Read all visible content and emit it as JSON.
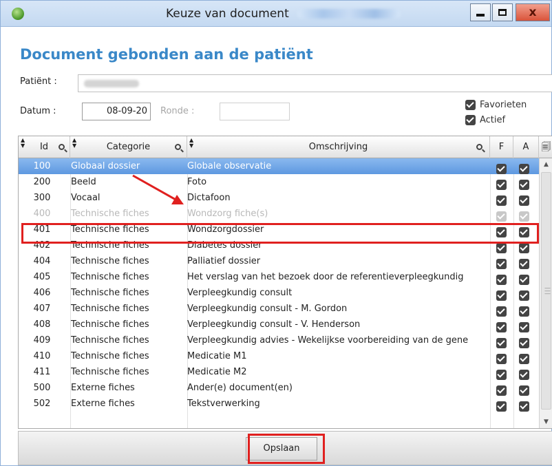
{
  "window": {
    "title": "Keuze van document",
    "controls": {
      "minimize": "minimize",
      "maximize": "maximize",
      "close": "x"
    }
  },
  "heading": "Document gebonden aan de patiënt",
  "form": {
    "patient_label": "Patiënt :",
    "datum_label": "Datum :",
    "datum_value": "08-09-20",
    "ronde_label": "Ronde :",
    "ronde_value": ""
  },
  "options": [
    {
      "label": "Favorieten",
      "checked": true
    },
    {
      "label": "Actief",
      "checked": true
    }
  ],
  "table": {
    "columns": {
      "id": "Id",
      "categorie": "Categorie",
      "omschrijving": "Omschrijving",
      "f": "F",
      "a": "A"
    },
    "rows": [
      {
        "id": "100",
        "categorie": "Globaal dossier",
        "omschrijving": "Globale observatie",
        "f": true,
        "a": true,
        "state": "selected"
      },
      {
        "id": "200",
        "categorie": "Beeld",
        "omschrijving": "Foto",
        "f": true,
        "a": true,
        "state": "normal"
      },
      {
        "id": "300",
        "categorie": "Vocaal",
        "omschrijving": "Dictafoon",
        "f": true,
        "a": true,
        "state": "normal"
      },
      {
        "id": "400",
        "categorie": "Technische fiches",
        "omschrijving": "Wondzorg fiche(s)",
        "f": true,
        "a": true,
        "state": "disabled"
      },
      {
        "id": "401",
        "categorie": "Technische fiches",
        "omschrijving": "Wondzorgdossier",
        "f": true,
        "a": true,
        "state": "normal"
      },
      {
        "id": "402",
        "categorie": "Technische fiches",
        "omschrijving": "Diabetes dossier",
        "f": true,
        "a": true,
        "state": "normal"
      },
      {
        "id": "404",
        "categorie": "Technische fiches",
        "omschrijving": "Palliatief dossier",
        "f": true,
        "a": true,
        "state": "normal"
      },
      {
        "id": "405",
        "categorie": "Technische fiches",
        "omschrijving": "Het verslag van het bezoek door de referentieverpleegkundig",
        "f": true,
        "a": true,
        "state": "normal"
      },
      {
        "id": "406",
        "categorie": "Technische fiches",
        "omschrijving": "Verpleegkundig consult",
        "f": true,
        "a": true,
        "state": "normal"
      },
      {
        "id": "407",
        "categorie": "Technische fiches",
        "omschrijving": "Verpleegkundig consult - M. Gordon",
        "f": true,
        "a": true,
        "state": "normal"
      },
      {
        "id": "408",
        "categorie": "Technische fiches",
        "omschrijving": "Verpleegkundig consult - V. Henderson",
        "f": true,
        "a": true,
        "state": "normal"
      },
      {
        "id": "409",
        "categorie": "Technische fiches",
        "omschrijving": "Verpleegkundig advies - Wekelijkse voorbereiding van de gene",
        "f": true,
        "a": true,
        "state": "normal"
      },
      {
        "id": "410",
        "categorie": "Technische fiches",
        "omschrijving": "Medicatie M1",
        "f": true,
        "a": true,
        "state": "normal"
      },
      {
        "id": "411",
        "categorie": "Technische fiches",
        "omschrijving": "Medicatie M2",
        "f": true,
        "a": true,
        "state": "normal"
      },
      {
        "id": "500",
        "categorie": "Externe fiches",
        "omschrijving": "Ander(e) document(en)",
        "f": true,
        "a": true,
        "state": "normal"
      },
      {
        "id": "502",
        "categorie": "Externe fiches",
        "omschrijving": "Tekstverwerking",
        "f": true,
        "a": true,
        "state": "normal"
      }
    ]
  },
  "footer": {
    "save_label": "Opslaan"
  },
  "colors": {
    "heading": "#3a88c8",
    "selection": "#5d98e0",
    "annotation": "#e0201f"
  }
}
